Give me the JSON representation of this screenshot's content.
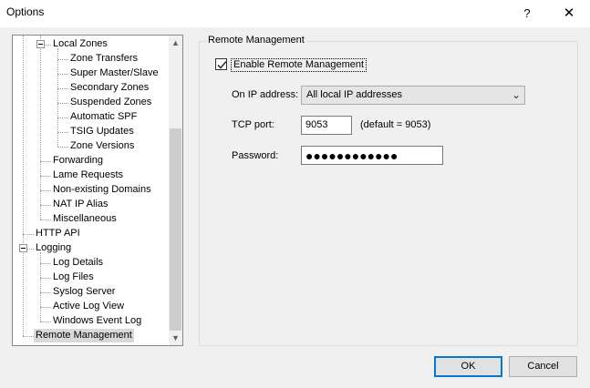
{
  "window": {
    "title": "Options",
    "help_label": "?",
    "close_label": "✕"
  },
  "tree": {
    "items": [
      {
        "label": "Local Zones",
        "level": 2,
        "expander": true
      },
      {
        "label": "Zone Transfers",
        "level": 3
      },
      {
        "label": "Super Master/Slave",
        "level": 3
      },
      {
        "label": "Secondary Zones",
        "level": 3
      },
      {
        "label": "Suspended Zones",
        "level": 3
      },
      {
        "label": "Automatic SPF",
        "level": 3
      },
      {
        "label": "TSIG Updates",
        "level": 3
      },
      {
        "label": "Zone Versions",
        "level": 3
      },
      {
        "label": "Forwarding",
        "level": 2
      },
      {
        "label": "Lame Requests",
        "level": 2
      },
      {
        "label": "Non-existing Domains",
        "level": 2
      },
      {
        "label": "NAT IP Alias",
        "level": 2
      },
      {
        "label": "Miscellaneous",
        "level": 2
      },
      {
        "label": "HTTP API",
        "level": 1
      },
      {
        "label": "Logging",
        "level": 1,
        "expander": true
      },
      {
        "label": "Log Details",
        "level": 2
      },
      {
        "label": "Log Files",
        "level": 2
      },
      {
        "label": "Syslog Server",
        "level": 2
      },
      {
        "label": "Active Log View",
        "level": 2
      },
      {
        "label": "Windows Event Log",
        "level": 2
      },
      {
        "label": "Remote Management",
        "level": 1,
        "selected": true
      }
    ],
    "scroll_up_icon": "chevron-up-icon",
    "scroll_down_icon": "chevron-down-icon"
  },
  "remote": {
    "group_title": "Remote Management",
    "enable_label": "Enable Remote Management",
    "enable_checked": true,
    "ip_label": "On IP address:",
    "ip_value": "All local IP addresses",
    "port_label": "TCP port:",
    "port_value": "9053",
    "port_hint": "(default = 9053)",
    "password_label": "Password:",
    "password_value": "●●●●●●●●●●●●"
  },
  "buttons": {
    "ok": "OK",
    "cancel": "Cancel"
  }
}
